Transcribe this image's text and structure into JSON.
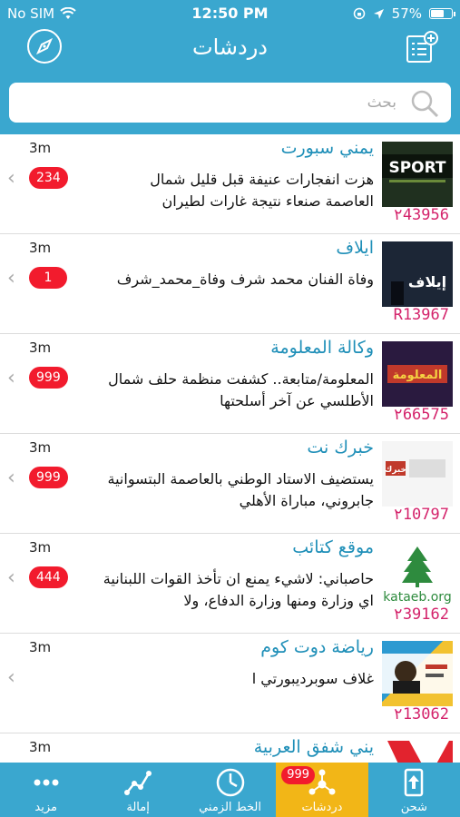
{
  "status_bar": {
    "carrier": "No SIM",
    "time": "12:50 PM",
    "battery": "57%",
    "battery_level": 0.57
  },
  "header": {
    "title": "دردشات"
  },
  "search": {
    "placeholder": "بحث"
  },
  "chats": [
    {
      "name": "يمني سبورت",
      "message": "هزت انفجارات عنيفة قبل قليل شمال العاصمة صنعاء نتيجة غارات لطيران",
      "time": "3m",
      "badge": "234",
      "subscribers": "٢43956",
      "thumb_text": "SPORT"
    },
    {
      "name": "ايلاف",
      "message": "وفاة الفنان محمد شرف وفاة_محمد_شرف",
      "time": "3m",
      "badge": "1",
      "subscribers": "R13967",
      "thumb_text": "إيلاف"
    },
    {
      "name": "وكالة المعلومة",
      "message": "المعلومة/متابعة.. كشفت منظمة حلف شمال الأطلسي عن آخر أسلحتها",
      "time": "3m",
      "badge": "999",
      "subscribers": "٢66575",
      "thumb_text": "المعلومة"
    },
    {
      "name": "خبرك نت",
      "message": "يستضيف الاستاد الوطني بالعاصمة البتسوانية جابروني، مباراة الأهلي",
      "time": "3m",
      "badge": "999",
      "subscribers": "٢10797",
      "thumb_text": "خبرك"
    },
    {
      "name": "موقع كتائب",
      "message": "حاصباني: لاشيء يمنع ان تأخذ القوات اللبنانية اي وزارة ومنها وزارة الدفاع، ولا",
      "time": "3m",
      "badge": "444",
      "subscribers": "٢39162",
      "thumb_text": "kataeb.org"
    },
    {
      "name": "رياضة دوت كوم",
      "message": "غلاف سوبرديبورتي ا",
      "time": "3m",
      "badge": "",
      "subscribers": "٢13062",
      "thumb_text": ""
    },
    {
      "name": "يني شفق العربية",
      "message": "",
      "time": "3m",
      "badge": "",
      "subscribers": "",
      "thumb_text": ""
    }
  ],
  "tabs": [
    {
      "label": "مزيد",
      "icon": "more-dots-icon"
    },
    {
      "label": "إمالة",
      "icon": "chart-line-icon"
    },
    {
      "label": "الخط الزمني",
      "icon": "clock-icon"
    },
    {
      "label": "دردشات",
      "icon": "share-nodes-icon",
      "badge": "999",
      "active": true
    },
    {
      "label": "شحن",
      "icon": "upload-phone-icon"
    }
  ],
  "colors": {
    "primary": "#3aa7cf",
    "active_tab": "#f2b617",
    "badge": "#f21b2d",
    "chat_name": "#1f8fb8",
    "subscribers": "#d4236b"
  }
}
